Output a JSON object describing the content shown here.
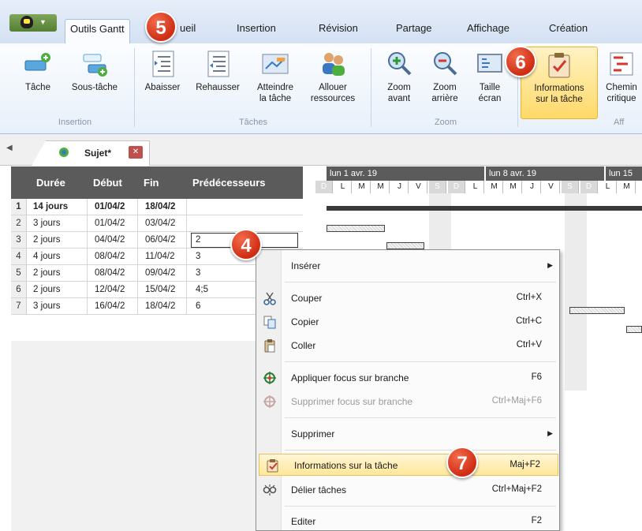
{
  "ribbon_tabs": [
    {
      "label": "Outils Gantt",
      "active": true
    },
    {
      "label": "ueil"
    },
    {
      "label": "Insertion"
    },
    {
      "label": "Révision"
    },
    {
      "label": "Partage"
    },
    {
      "label": "Affichage"
    },
    {
      "label": "Création"
    }
  ],
  "ribbon": {
    "buttons": [
      {
        "label": "Tâche"
      },
      {
        "label": "Sous-tâche"
      },
      {
        "label": "Abaisser"
      },
      {
        "label": "Rehausser"
      },
      {
        "label": "Atteindre\nla tâche"
      },
      {
        "label": "Allouer\nressources"
      },
      {
        "label": "Zoom\navant"
      },
      {
        "label": "Zoom\narrière"
      },
      {
        "label": "Taille\nécran"
      },
      {
        "label": "Informations\nsur la tâche"
      },
      {
        "label": "Chemin\ncritique"
      }
    ],
    "groups": [
      {
        "label": "Insertion"
      },
      {
        "label": "Tâches"
      },
      {
        "label": "Zoom"
      },
      {
        "label": "Aff"
      }
    ]
  },
  "document_tab": {
    "label": "Sujet*"
  },
  "grid": {
    "columns": [
      "Durée",
      "Début",
      "Fin",
      "Prédécesseurs"
    ],
    "rows": [
      {
        "num": "1",
        "duree": "14 jours",
        "debut": "01/04/2",
        "fin": "18/04/2",
        "pred": ""
      },
      {
        "num": "2",
        "duree": "3 jours",
        "debut": "01/04/2",
        "fin": "03/04/2",
        "pred": ""
      },
      {
        "num": "3",
        "duree": "2 jours",
        "debut": "04/04/2",
        "fin": "06/04/2",
        "pred": "2"
      },
      {
        "num": "4",
        "duree": "4 jours",
        "debut": "08/04/2",
        "fin": "11/04/2",
        "pred": "3"
      },
      {
        "num": "5",
        "duree": "2 jours",
        "debut": "08/04/2",
        "fin": "09/04/2",
        "pred": "3"
      },
      {
        "num": "6",
        "duree": "2 jours",
        "debut": "12/04/2",
        "fin": "15/04/2",
        "pred": "4;5"
      },
      {
        "num": "7",
        "duree": "3 jours",
        "debut": "16/04/2",
        "fin": "18/04/2",
        "pred": "6"
      }
    ]
  },
  "gantt": {
    "weeks": [
      "lun 1 avr. 19",
      "lun 8 avr. 19",
      "lun 15"
    ],
    "days": [
      "D",
      "L",
      "M",
      "M",
      "J",
      "V",
      "S",
      "D",
      "L",
      "M",
      "M",
      "J",
      "V",
      "S",
      "D",
      "L",
      "M"
    ]
  },
  "context_menu": {
    "items": [
      {
        "label": "Insérer",
        "shortcut": "",
        "submenu": true
      },
      {
        "label": "Couper",
        "shortcut": "Ctrl+X",
        "icon": "scissors-icon"
      },
      {
        "label": "Copier",
        "shortcut": "Ctrl+C",
        "icon": "copy-icon"
      },
      {
        "label": "Coller",
        "shortcut": "Ctrl+V",
        "icon": "paste-icon"
      },
      {
        "label": "Appliquer focus sur branche",
        "shortcut": "F6",
        "icon": "focus-branch-icon"
      },
      {
        "label": "Supprimer focus sur branche",
        "shortcut": "Ctrl+Maj+F6",
        "icon": "remove-focus-icon",
        "disabled": true
      },
      {
        "label": "Supprimer",
        "shortcut": "",
        "submenu": true
      },
      {
        "label": "Informations sur la tâche",
        "shortcut": "Maj+F2",
        "icon": "task-info-icon",
        "highlighted": true
      },
      {
        "label": "Délier tâches",
        "shortcut": "Ctrl+Maj+F2",
        "icon": "unlink-icon"
      },
      {
        "label": "Editer",
        "shortcut": "F2"
      }
    ]
  },
  "callouts": [
    "5",
    "6",
    "4",
    "7"
  ],
  "colors": {
    "accent_red": "#cf2d14",
    "highlight": "#ffd968",
    "header_gray": "#5b5b5b"
  }
}
